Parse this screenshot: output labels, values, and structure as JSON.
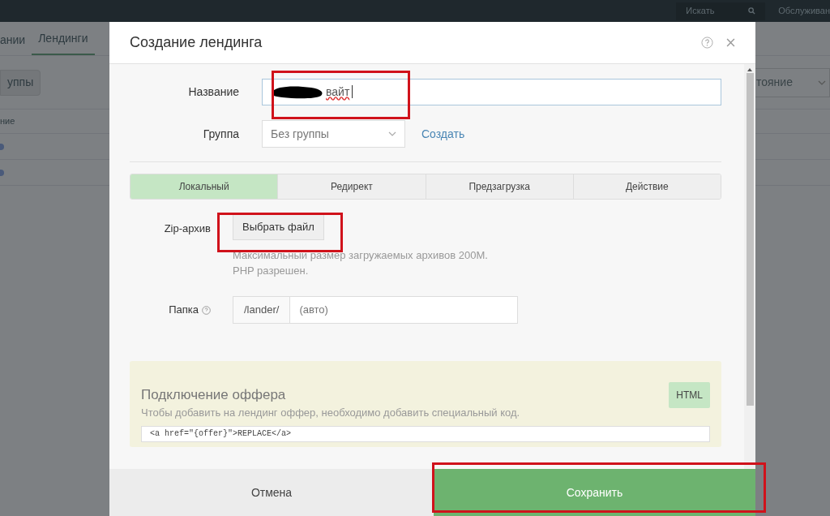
{
  "topbar": {
    "search_placeholder": "Искать",
    "menu_item": "Обслуживан"
  },
  "background": {
    "tabs": [
      {
        "label": "ании",
        "selected": false
      },
      {
        "label": "Лендинги",
        "selected": true
      }
    ],
    "button": "уппы",
    "column": "ние",
    "filter": "тояние"
  },
  "dialog": {
    "title": "Создание лендинга",
    "name_field": {
      "label": "Название",
      "value": "вайт"
    },
    "group_field": {
      "label": "Группа",
      "value": "Без группы",
      "create_link": "Создать"
    },
    "tabs": [
      {
        "label": "Локальный",
        "selected": true
      },
      {
        "label": "Редирект",
        "selected": false
      },
      {
        "label": "Предзагрузка",
        "selected": false
      },
      {
        "label": "Действие",
        "selected": false
      }
    ],
    "zip": {
      "label": "Zip-архив",
      "button": "Выбрать файл",
      "hint": "Максимальный размер загружаемых архивов 200M. PHP разрешен."
    },
    "folder": {
      "label": "Папка",
      "prefix": "/lander/",
      "placeholder": "(авто)"
    },
    "offer": {
      "title": "Подключение оффера",
      "description": "Чтобы добавить на лендинг оффер, необходимо добавить специальный код.",
      "badge": "HTML",
      "code": "<a href=\"{offer}\">REPLACE</a>"
    },
    "footer": {
      "cancel": "Отмена",
      "save": "Сохранить"
    }
  }
}
